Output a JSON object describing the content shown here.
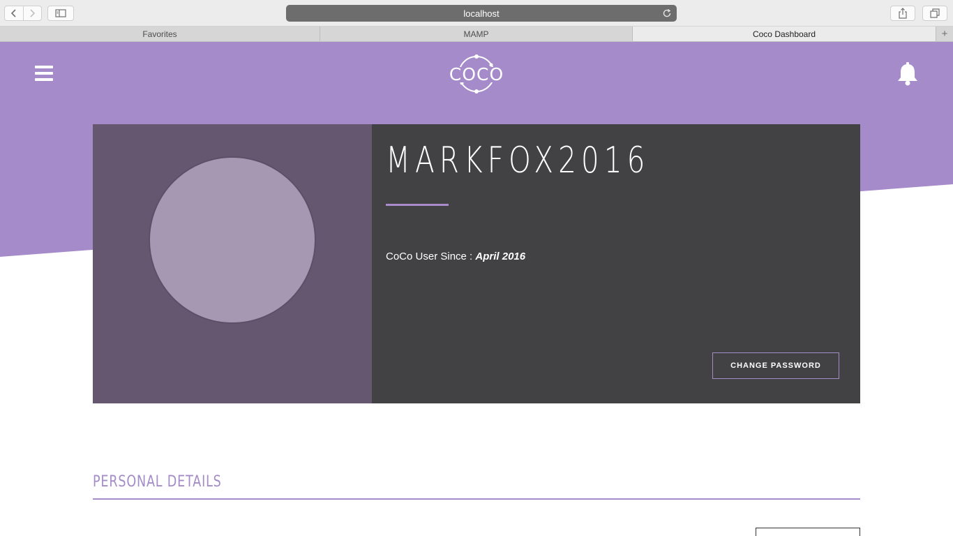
{
  "browser": {
    "url": "localhost",
    "tabs": [
      {
        "label": "Favorites",
        "active": false
      },
      {
        "label": "MAMP",
        "active": false
      },
      {
        "label": "Coco Dashboard",
        "active": true
      }
    ],
    "new_tab_label": "+"
  },
  "header": {
    "logo_text": "COCO",
    "menu_icon": "hamburger-menu-icon",
    "notification_icon": "bell-icon",
    "brand_color": "#a58bca"
  },
  "profile": {
    "username": "MARKFOX2016",
    "since_label": "CoCo User Since : ",
    "since_value": "April 2016",
    "change_password_label": "CHANGE PASSWORD",
    "avatar_color": "#a698b2"
  },
  "personal_details": {
    "title": "PERSONAL DETAILS"
  }
}
